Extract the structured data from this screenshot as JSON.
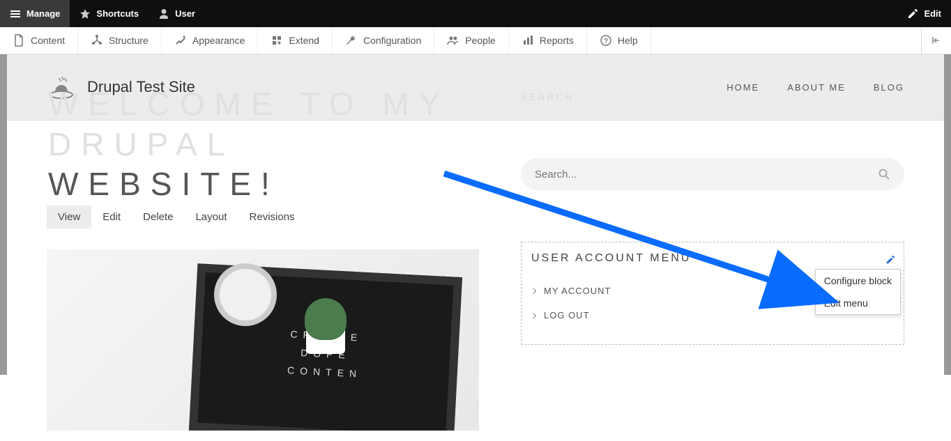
{
  "toolbar_black": {
    "manage": "Manage",
    "shortcuts": "Shortcuts",
    "user": "User",
    "edit": "Edit"
  },
  "toolbar_white": {
    "content": "Content",
    "structure": "Structure",
    "appearance": "Appearance",
    "extend": "Extend",
    "configuration": "Configuration",
    "people": "People",
    "reports": "Reports",
    "help": "Help"
  },
  "site": {
    "name": "Drupal Test Site",
    "nav": {
      "home": "HOME",
      "about": "ABOUT ME",
      "blog": "BLOG"
    }
  },
  "page": {
    "title_line1": "WELCOME TO MY DRUPAL",
    "title_line2": "WEBSITE!",
    "tabs": {
      "view": "View",
      "edit": "Edit",
      "delete": "Delete",
      "layout": "Layout",
      "revisions": "Revisions"
    },
    "letterboard": {
      "l1": "CREATE",
      "l2": "DOPE",
      "l3": "CONTEN"
    }
  },
  "sidebar": {
    "search_label": "SEARCH",
    "search_placeholder": "Search...",
    "block_title": "USER ACCOUNT MENU",
    "items": {
      "account": "MY ACCOUNT",
      "logout": "LOG OUT"
    },
    "context": {
      "configure": "Configure block",
      "edit_menu": "Edit menu"
    }
  }
}
